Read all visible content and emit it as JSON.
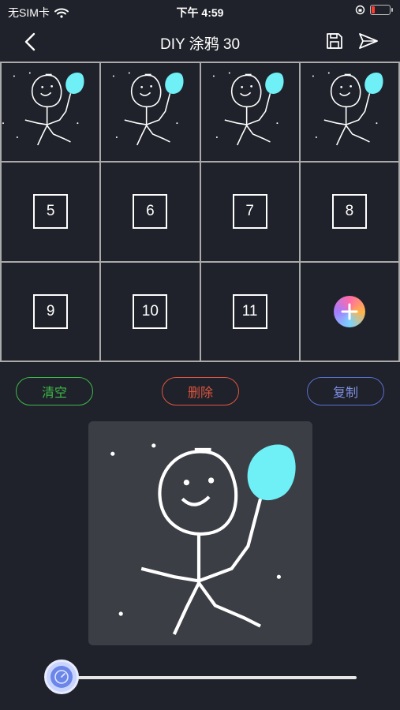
{
  "status": {
    "carrier": "无SIM卡",
    "time": "下午 4:59"
  },
  "nav": {
    "title": "DIY 涂鸦 30"
  },
  "frames": [
    {
      "type": "thumb"
    },
    {
      "type": "thumb"
    },
    {
      "type": "thumb"
    },
    {
      "type": "thumb"
    },
    {
      "type": "number",
      "label": "5"
    },
    {
      "type": "number",
      "label": "6"
    },
    {
      "type": "number",
      "label": "7"
    },
    {
      "type": "number",
      "label": "8"
    },
    {
      "type": "number",
      "label": "9"
    },
    {
      "type": "number",
      "label": "10"
    },
    {
      "type": "number",
      "label": "11"
    },
    {
      "type": "add"
    }
  ],
  "actions": {
    "clear_label": "清空",
    "delete_label": "删除",
    "copy_label": "复制"
  },
  "colors": {
    "balloon": "#6ff0f7",
    "stroke": "#ffffff",
    "clear": "#3fb84a",
    "delete": "#e0553f",
    "copy": "#5a6fd0"
  },
  "icons": {
    "back": "chevron-left-icon",
    "save": "save-icon",
    "send": "send-icon",
    "add": "plus-icon",
    "slider": "speed-dial-icon"
  },
  "slider": {
    "value": 0
  }
}
